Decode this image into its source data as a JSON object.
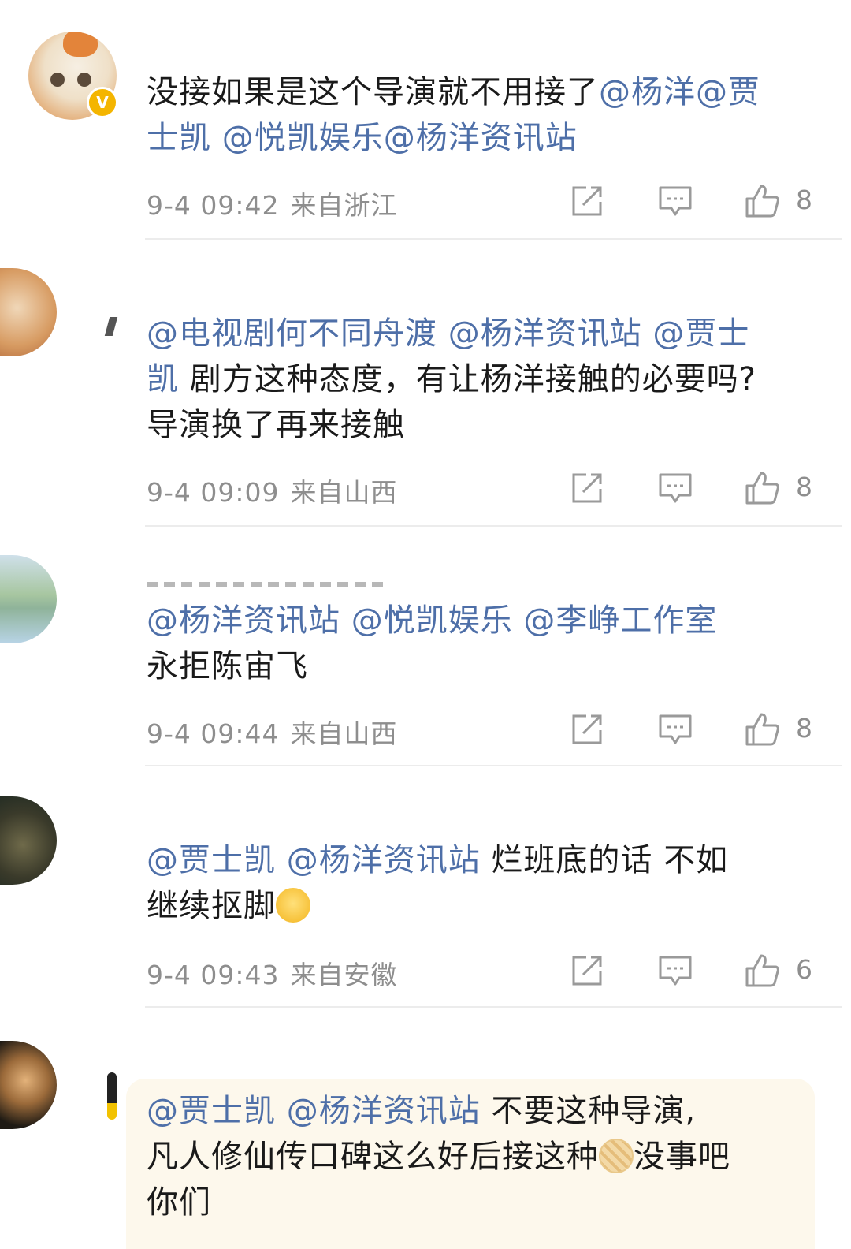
{
  "comments": [
    {
      "mentions_line1": "没接如果是这个导演就不用接了",
      "mention_a": "@杨洋@贾",
      "mention_b": "士凯 @悦凯娱乐@杨洋资讯站",
      "time": "9-4 09:42",
      "location": "来自浙江",
      "likes": "8"
    },
    {
      "mention_a": "@电视剧何不同舟渡 @杨洋资讯站 @贾士",
      "mention_b": "凯",
      "body_after_b": " 剧方这种态度，有让杨洋接触的必要吗?",
      "body_line3": "导演换了再来接触",
      "time": "9-4 09:09",
      "location": "来自山西",
      "likes": "8"
    },
    {
      "mention_a": "@杨洋资讯站 @悦凯娱乐 @李峥工作室",
      "body_line2": "永拒陈宙飞",
      "time": "9-4 09:44",
      "location": "来自山西",
      "likes": "8"
    },
    {
      "mention_a": "@贾士凯  @杨洋资讯站",
      "body_after_a": " 烂班底的话 不如",
      "body_line2": "继续抠脚",
      "emoji": "thinking-face-emoji",
      "time": "9-4 09:43",
      "location": "来自安徽",
      "likes": "6"
    },
    {
      "mention_a": "@贾士凯 @杨洋资讯站",
      "body_after_a": " 不要这种导演,",
      "body_line2a": "凡人修仙传口碑这么好后接这种",
      "emoji": "biscuit-emoji",
      "body_line2b": "没事吧",
      "body_line3": "你们"
    }
  ],
  "colors": {
    "mention": "#4e6fa8",
    "text": "#1a1a1a",
    "meta": "#8e8e8e",
    "divider": "#ececec"
  },
  "icons": [
    "share-icon",
    "comment-icon",
    "like-icon"
  ]
}
